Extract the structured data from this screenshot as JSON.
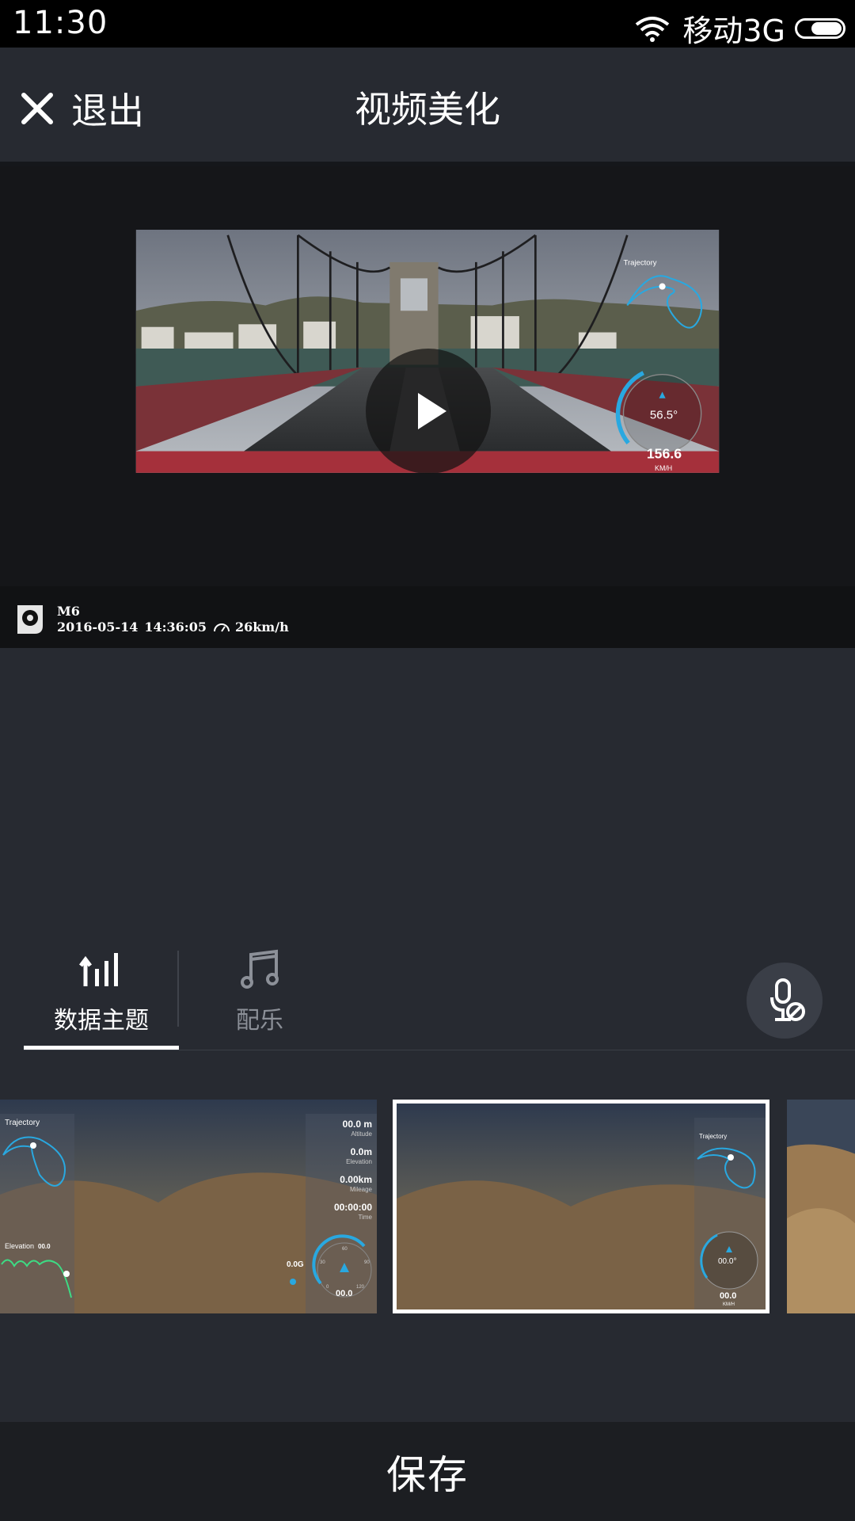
{
  "status_bar": {
    "time": "11:30",
    "carrier": "移动3G",
    "icons": [
      "wifi-icon",
      "battery-icon"
    ]
  },
  "nav": {
    "exit_label": "退出",
    "title": "视频美化",
    "close_icon": "close-icon"
  },
  "preview": {
    "overlay": {
      "trajectory_label": "Trajectory",
      "compass_reading": "56.5°",
      "speed_value": "156.6",
      "speed_unit": "KM/H"
    },
    "watermark": {
      "device": "M6",
      "date": "2016-05-14",
      "time": "14:36:05",
      "speed": "26km/h"
    },
    "play_icon": "play-icon"
  },
  "tabs": [
    {
      "label": "数据主题",
      "icon": "bar-chart-icon",
      "active": true
    },
    {
      "label": "配乐",
      "icon": "music-note-icon",
      "active": false
    }
  ],
  "mic_button": {
    "icon": "mic-off-icon"
  },
  "themes": [
    {
      "trajectory": "Trajectory",
      "elevation_label": "Elevation",
      "elevation_value": "00.0",
      "altitude_value": "00.0 m",
      "altitude_label": "Altitude",
      "elevation_m_value": "0.0m",
      "elevation_m_label": "Elevation",
      "mileage_value": "0.00km",
      "mileage_label": "Mileage",
      "time_value": "00:00:00",
      "time_label": "Time",
      "g_value": "0.0G",
      "speed_value": "00.0",
      "gauge_ticks": [
        "60",
        "30",
        "90",
        "0",
        "120"
      ],
      "selected": false
    },
    {
      "trajectory": "Trajectory",
      "compass_reading": "00.0°",
      "speed_value": "00.0",
      "speed_unit": "KM/H",
      "selected": true
    },
    {
      "selected": false
    }
  ],
  "save_label": "保存"
}
